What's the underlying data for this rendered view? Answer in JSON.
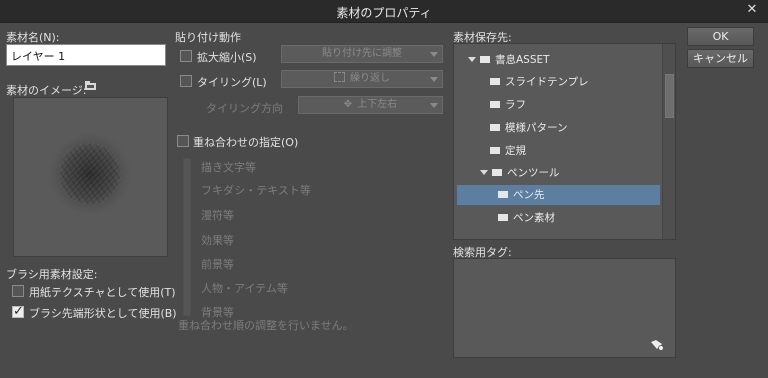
{
  "window": {
    "title": "素材のプロパティ",
    "close_glyph": "✕"
  },
  "left": {
    "name_label": "素材名(N):",
    "name_value": "レイヤー 1",
    "image_label": "素材のイメージ:",
    "brush_section_label": "ブラシ用素材設定:",
    "paper_texture": {
      "label": "用紙テクスチャとして使用(T)",
      "checked": false
    },
    "brush_tip": {
      "label": "ブラシ先端形状として使用(B)",
      "checked": true
    }
  },
  "paste": {
    "section_label": "貼り付け動作",
    "scale": {
      "label": "拡大縮小(S)",
      "checked": false,
      "dropdown_value": "貼り付け先に調整"
    },
    "tiling": {
      "label": "タイリング(L)",
      "checked": false,
      "dropdown_value": "繰り返し"
    },
    "tiling_direction": {
      "label": "タイリング方向",
      "dropdown_value": "上下左右"
    }
  },
  "overlay": {
    "label": "重ね合わせの指定(O)",
    "checked": false,
    "items": [
      "描き文字等",
      "フキダシ・テキスト等",
      "漫符等",
      "効果等",
      "前景等",
      "人物・アイテム等",
      "背景等"
    ],
    "note": "重ね合わせ順の調整を行いません。"
  },
  "save_location": {
    "label": "素材保存先:",
    "tree": [
      "書息ASSET",
      "スライドテンプレ",
      "ラフ",
      "模様パターン",
      "定規",
      "ペンツール",
      "ペン先",
      "ペン素材"
    ]
  },
  "search_tags": {
    "label": "検索用タグ:"
  },
  "buttons": {
    "ok": "OK",
    "cancel": "キャンセル"
  }
}
